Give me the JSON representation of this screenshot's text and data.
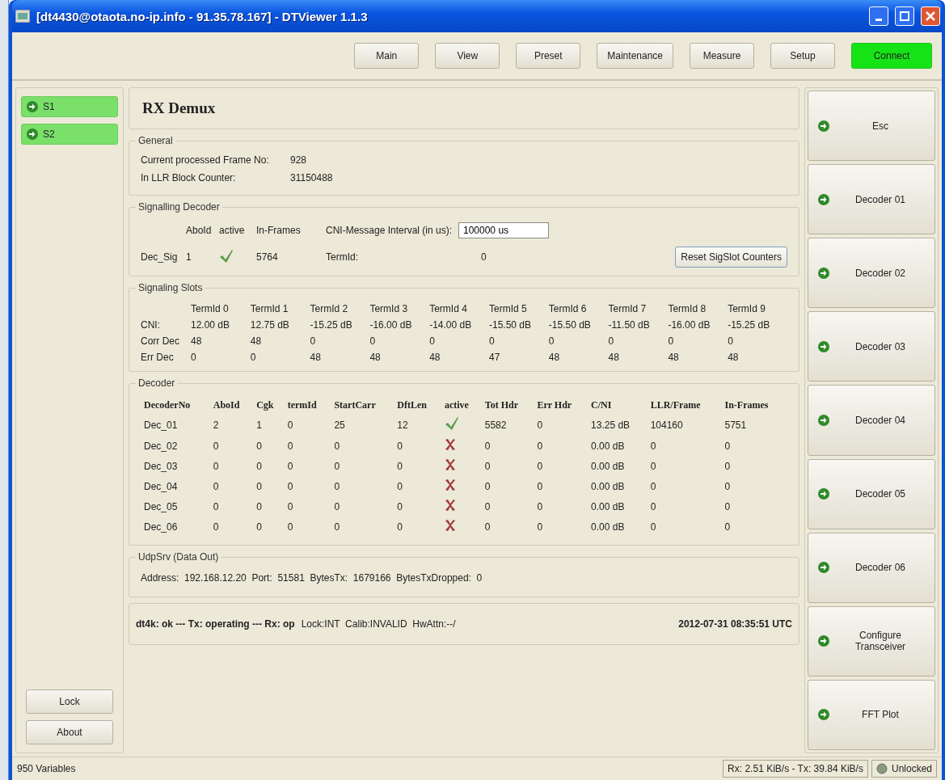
{
  "window": {
    "title": "[dt4430@otaota.no-ip.info - 91.35.78.167] - DTViewer 1.1.3"
  },
  "toolbar": [
    {
      "label": "Main",
      "kind": "plain"
    },
    {
      "label": "View",
      "kind": "plain"
    },
    {
      "label": "Preset",
      "kind": "plain"
    },
    {
      "label": "Maintenance",
      "kind": "plain"
    },
    {
      "label": "Measure",
      "kind": "plain"
    },
    {
      "label": "Setup",
      "kind": "plain"
    },
    {
      "label": "Connect",
      "kind": "green"
    }
  ],
  "left_nav": [
    "S1",
    "S2"
  ],
  "left_buttons": [
    "Lock",
    "About"
  ],
  "page_title": "RX Demux",
  "general": {
    "title": "General",
    "rows": [
      {
        "label": "Current processed Frame No:",
        "value": "928"
      },
      {
        "label": "In LLR Block Counter:",
        "value": "31150488"
      }
    ]
  },
  "signalling_decoder": {
    "title": "Signalling Decoder",
    "headers": [
      "AboId",
      "active",
      "In-Frames"
    ],
    "interval_label": "CNI-Message Interval (in us):",
    "interval_value": "100000 us",
    "row_label": "Dec_Sig",
    "abo_id": "1",
    "active": true,
    "in_frames": "5764",
    "termid_label": "TermId:",
    "termid_value": "0",
    "reset_button": "Reset SigSlot Counters"
  },
  "signaling_slots": {
    "title": "Signaling Slots",
    "columns": [
      "TermId 0",
      "TermId 1",
      "TermId 2",
      "TermId 3",
      "TermId 4",
      "TermId 5",
      "TermId 6",
      "TermId 7",
      "TermId 8",
      "TermId 9"
    ],
    "rows": [
      {
        "label": "CNI:",
        "values": [
          "12.00 dB",
          "12.75 dB",
          "-15.25 dB",
          "-16.00 dB",
          "-14.00 dB",
          "-15.50 dB",
          "-15.50 dB",
          "-11.50 dB",
          "-16.00 dB",
          "-15.25 dB"
        ]
      },
      {
        "label": "Corr Dec",
        "values": [
          "48",
          "48",
          "0",
          "0",
          "0",
          "0",
          "0",
          "0",
          "0",
          "0"
        ]
      },
      {
        "label": "Err Dec",
        "values": [
          "0",
          "0",
          "48",
          "48",
          "48",
          "47",
          "48",
          "48",
          "48",
          "48"
        ]
      }
    ]
  },
  "decoder": {
    "title": "Decoder",
    "columns": [
      "DecoderNo",
      "AboId",
      "Cgk",
      "termId",
      "StartCarr",
      "DftLen",
      "active",
      "Tot Hdr",
      "Err Hdr",
      "C/NI",
      "LLR/Frame",
      "In-Frames"
    ],
    "rows": [
      {
        "name": "Dec_01",
        "abo_id": "2",
        "cgk": "1",
        "term_id": "0",
        "start_carr": "25",
        "dft_len": "12",
        "active": true,
        "tot_hdr": "5582",
        "err_hdr": "0",
        "cni": "13.25 dB",
        "llr_frame": "104160",
        "in_frames": "5751"
      },
      {
        "name": "Dec_02",
        "abo_id": "0",
        "cgk": "0",
        "term_id": "0",
        "start_carr": "0",
        "dft_len": "0",
        "active": false,
        "tot_hdr": "0",
        "err_hdr": "0",
        "cni": "0.00 dB",
        "llr_frame": "0",
        "in_frames": "0"
      },
      {
        "name": "Dec_03",
        "abo_id": "0",
        "cgk": "0",
        "term_id": "0",
        "start_carr": "0",
        "dft_len": "0",
        "active": false,
        "tot_hdr": "0",
        "err_hdr": "0",
        "cni": "0.00 dB",
        "llr_frame": "0",
        "in_frames": "0"
      },
      {
        "name": "Dec_04",
        "abo_id": "0",
        "cgk": "0",
        "term_id": "0",
        "start_carr": "0",
        "dft_len": "0",
        "active": false,
        "tot_hdr": "0",
        "err_hdr": "0",
        "cni": "0.00 dB",
        "llr_frame": "0",
        "in_frames": "0"
      },
      {
        "name": "Dec_05",
        "abo_id": "0",
        "cgk": "0",
        "term_id": "0",
        "start_carr": "0",
        "dft_len": "0",
        "active": false,
        "tot_hdr": "0",
        "err_hdr": "0",
        "cni": "0.00 dB",
        "llr_frame": "0",
        "in_frames": "0"
      },
      {
        "name": "Dec_06",
        "abo_id": "0",
        "cgk": "0",
        "term_id": "0",
        "start_carr": "0",
        "dft_len": "0",
        "active": false,
        "tot_hdr": "0",
        "err_hdr": "0",
        "cni": "0.00 dB",
        "llr_frame": "0",
        "in_frames": "0"
      }
    ]
  },
  "udp_srv": {
    "title": "UdpSrv (Data Out)",
    "line": "Address:  192.168.12.20  Port:  51581  BytesTx:  1679166  BytesTxDropped:  0"
  },
  "status_line": {
    "bold_part": "dt4k: ok --- Tx: operating --- Rx: op",
    "plain_part": "Lock:INT  Calib:INVALID  HwAttn:--/",
    "time": "2012-07-31 08:35:51 UTC"
  },
  "right_nav": [
    "Esc",
    "Decoder 01",
    "Decoder 02",
    "Decoder 03",
    "Decoder 04",
    "Decoder 05",
    "Decoder 06",
    "Configure Transceiver",
    "FFT Plot"
  ],
  "status_bar": {
    "variables": "950 Variables",
    "rates": "Rx: 2.51 KiB/s - Tx: 39.84 KiB/s",
    "lock_state": "Unlocked"
  }
}
